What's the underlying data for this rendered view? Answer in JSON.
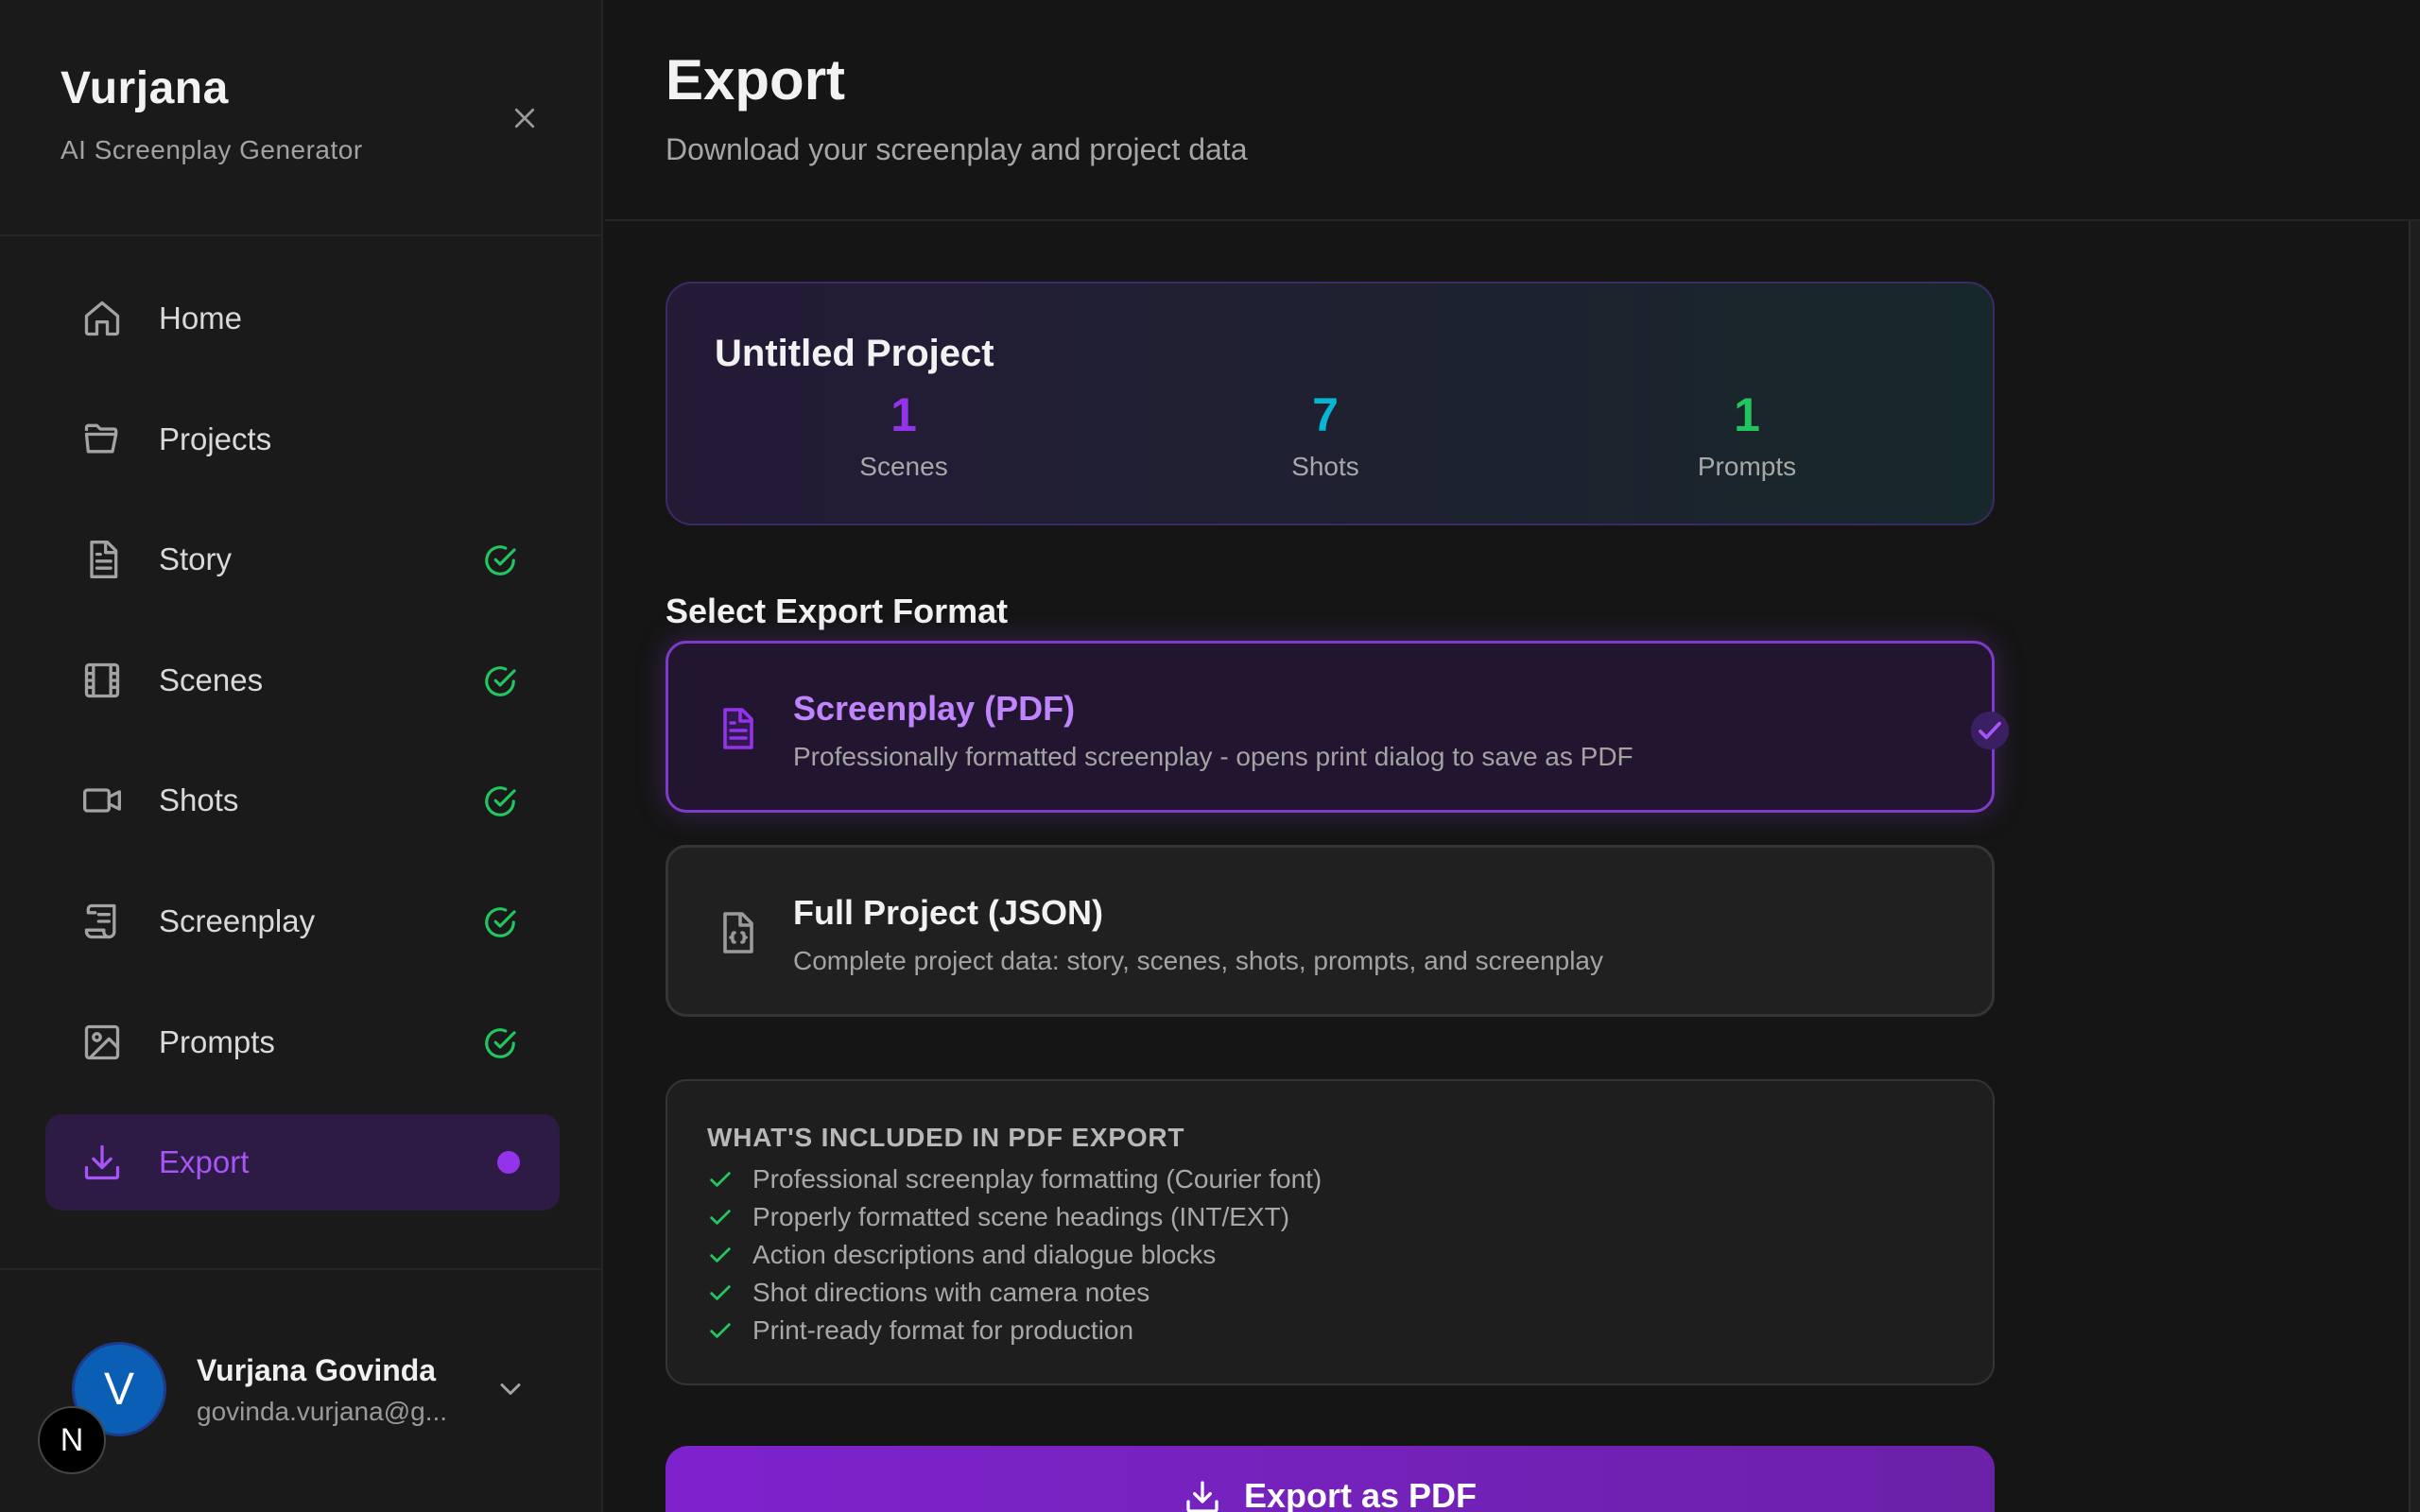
{
  "sidebar": {
    "brand_title": "Vurjana",
    "brand_subtitle": "AI Screenplay Generator",
    "close_icon": "close-icon",
    "items": [
      {
        "label": "Home",
        "icon": "home-icon",
        "status": "none"
      },
      {
        "label": "Projects",
        "icon": "folder-icon",
        "status": "none"
      },
      {
        "label": "Story",
        "icon": "document-icon",
        "status": "complete"
      },
      {
        "label": "Scenes",
        "icon": "film-icon",
        "status": "complete"
      },
      {
        "label": "Shots",
        "icon": "video-camera-icon",
        "status": "complete"
      },
      {
        "label": "Screenplay",
        "icon": "scroll-icon",
        "status": "complete"
      },
      {
        "label": "Prompts",
        "icon": "image-icon",
        "status": "complete"
      },
      {
        "label": "Export",
        "icon": "download-icon",
        "status": "active"
      }
    ],
    "user": {
      "avatar_letter": "V",
      "name": "Vurjana Govinda",
      "email": "govinda.vurjana@g..."
    },
    "badge_letter": "N"
  },
  "header": {
    "title": "Export",
    "subtitle": "Download your screenplay and project data"
  },
  "project": {
    "name": "Untitled Project",
    "stats": [
      {
        "value": "1",
        "label": "Scenes",
        "color": "#9333ea"
      },
      {
        "value": "7",
        "label": "Shots",
        "color": "#06b6d4"
      },
      {
        "value": "1",
        "label": "Prompts",
        "color": "#22c55e"
      }
    ]
  },
  "formats": {
    "section_title": "Select Export Format",
    "options": [
      {
        "title": "Screenplay (PDF)",
        "description": "Professionally formatted screenplay - opens print dialog to save as PDF",
        "selected": true
      },
      {
        "title": "Full Project (JSON)",
        "description": "Complete project data: story, scenes, shots, prompts, and screenplay",
        "selected": false
      }
    ]
  },
  "included": {
    "heading": "WHAT'S INCLUDED IN PDF EXPORT",
    "items": [
      "Professional screenplay formatting (Courier font)",
      "Properly formatted scene headings (INT/EXT)",
      "Action descriptions and dialogue blocks",
      "Shot directions with camera notes",
      "Print-ready format for production"
    ]
  },
  "export_button": {
    "label": "Export as PDF"
  },
  "colors": {
    "accent": "#9333ea",
    "success": "#22c55e",
    "cyan": "#06b6d4"
  }
}
